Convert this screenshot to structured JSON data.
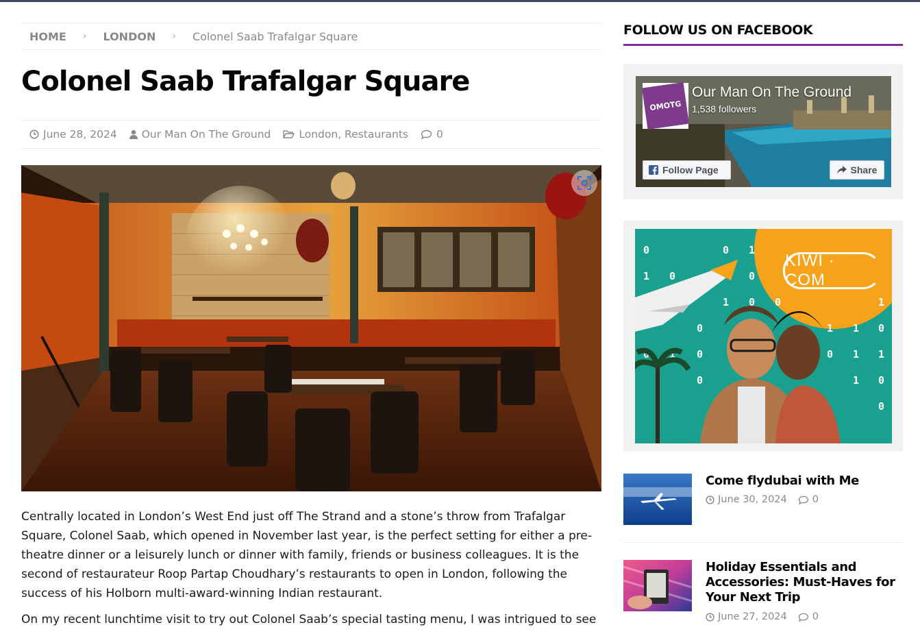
{
  "breadcrumb": {
    "home": "HOME",
    "section": "LONDON",
    "current": "Colonel Saab Trafalgar Square",
    "separator": "›"
  },
  "article": {
    "title": "Colonel Saab Trafalgar Square",
    "date": "June 28, 2024",
    "author": "Our Man On The Ground",
    "categories": "London, Restaurants",
    "comments": "0",
    "paragraph1": "Centrally located in London’s West End just off The Strand and a stone’s throw from Trafalgar Square, Colonel Saab, which opened in November last year, is the perfect setting for either a pre-theatre dinner or a leisurely lunch or dinner with family, friends or business colleagues. It is the second of restaurateur Roop Partap Choudhary’s restaurants to open in London, following the success of his Holborn multi-award-winning Indian restaurant.",
    "paragraph2": "On my recent lunchtime visit to try out Colonel Saab’s special tasting menu, I was intrigued to see"
  },
  "sidebar": {
    "facebook_heading": "FOLLOW US ON FACEBOOK",
    "fb_page_name": "Our Man On The Ground",
    "fb_followers": "1,538 followers",
    "fb_logo_text": "OMOTG",
    "fb_follow": "Follow Page",
    "fb_share": "Share",
    "ad_brand": "KIWI · COM",
    "posts": [
      {
        "title": "Come flydubai with Me",
        "date": "June 30, 2024",
        "comments": "0"
      },
      {
        "title": "Holiday Essentials and Accessories: Must-Haves for Your Next Trip",
        "date": "June 27, 2024",
        "comments": "0"
      }
    ]
  },
  "colors": {
    "accent": "#7c2f9e",
    "topbar": "#3f4a5e",
    "meta_text": "#8a8a8a"
  },
  "icons": [
    "clock-icon",
    "user-icon",
    "folder-icon",
    "comment-icon",
    "zoom-icon",
    "facebook-icon",
    "share-icon"
  ]
}
